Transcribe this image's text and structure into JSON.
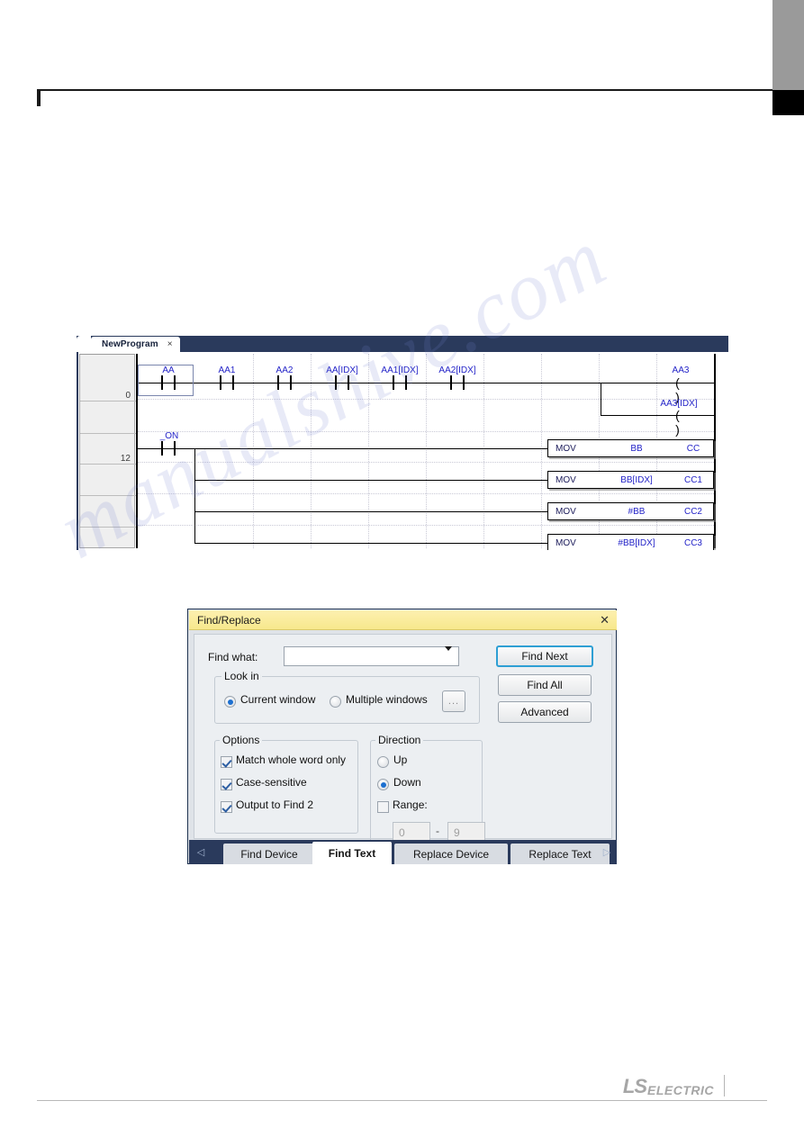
{
  "ladder": {
    "tab_label": "NewProgram",
    "tab_close": "×",
    "row_numbers": [
      "0",
      "12"
    ],
    "rung1": {
      "contacts": [
        "AA",
        "AA1",
        "AA2",
        "AA[IDX]",
        "AA1[IDX]",
        "AA2[IDX]"
      ],
      "coils": [
        "AA3",
        "AA3[IDX]"
      ],
      "coil_glyph": "( )"
    },
    "rung2": {
      "contact": "_ON",
      "instructions": [
        {
          "op": "MOV",
          "operand_a": "BB",
          "operand_b": "CC"
        },
        {
          "op": "MOV",
          "operand_a": "BB[IDX]",
          "operand_b": "CC1"
        },
        {
          "op": "MOV",
          "operand_a": "#BB",
          "operand_b": "CC2"
        },
        {
          "op": "MOV",
          "operand_a": "#BB[IDX]",
          "operand_b": "CC3"
        }
      ]
    }
  },
  "dialog": {
    "title": "Find/Replace",
    "close_glyph": "✕",
    "find_what_label": "Find what:",
    "find_what_value": "",
    "look_in": {
      "group_label": "Look in",
      "options": [
        "Current window",
        "Multiple windows"
      ],
      "selected": "Current window",
      "browse_label": "..."
    },
    "options": {
      "group_label": "Options",
      "items": [
        {
          "label": "Match whole word only",
          "checked": true
        },
        {
          "label": "Case-sensitive",
          "checked": true
        },
        {
          "label": "Output to Find 2",
          "checked": true
        }
      ]
    },
    "direction": {
      "group_label": "Direction",
      "options": [
        "Up",
        "Down"
      ],
      "selected": "Down",
      "range_label": "Range:",
      "range_checked": false,
      "range_from": "0",
      "range_to": "9",
      "range_separator": "-"
    },
    "buttons": {
      "find_next": "Find Next",
      "find_all": "Find All",
      "advanced": "Advanced"
    },
    "tabs": [
      {
        "label": "Find Device",
        "active": false
      },
      {
        "label": "Find Text",
        "active": true
      },
      {
        "label": "Replace Device",
        "active": false
      },
      {
        "label": "Replace Text",
        "active": false
      }
    ],
    "nav_prev": "◁",
    "nav_next": "▷"
  },
  "watermark": {
    "text": "manualshive.com"
  },
  "footer": {
    "brand_ls": "LS",
    "brand_electric": "ELECTRIC"
  },
  "colors": {
    "device_blue": "#2323c8",
    "title_yellow": "#f7e88c",
    "tabbar_navy": "#2a3a5c",
    "focus_blue": "#2e9fd4"
  }
}
